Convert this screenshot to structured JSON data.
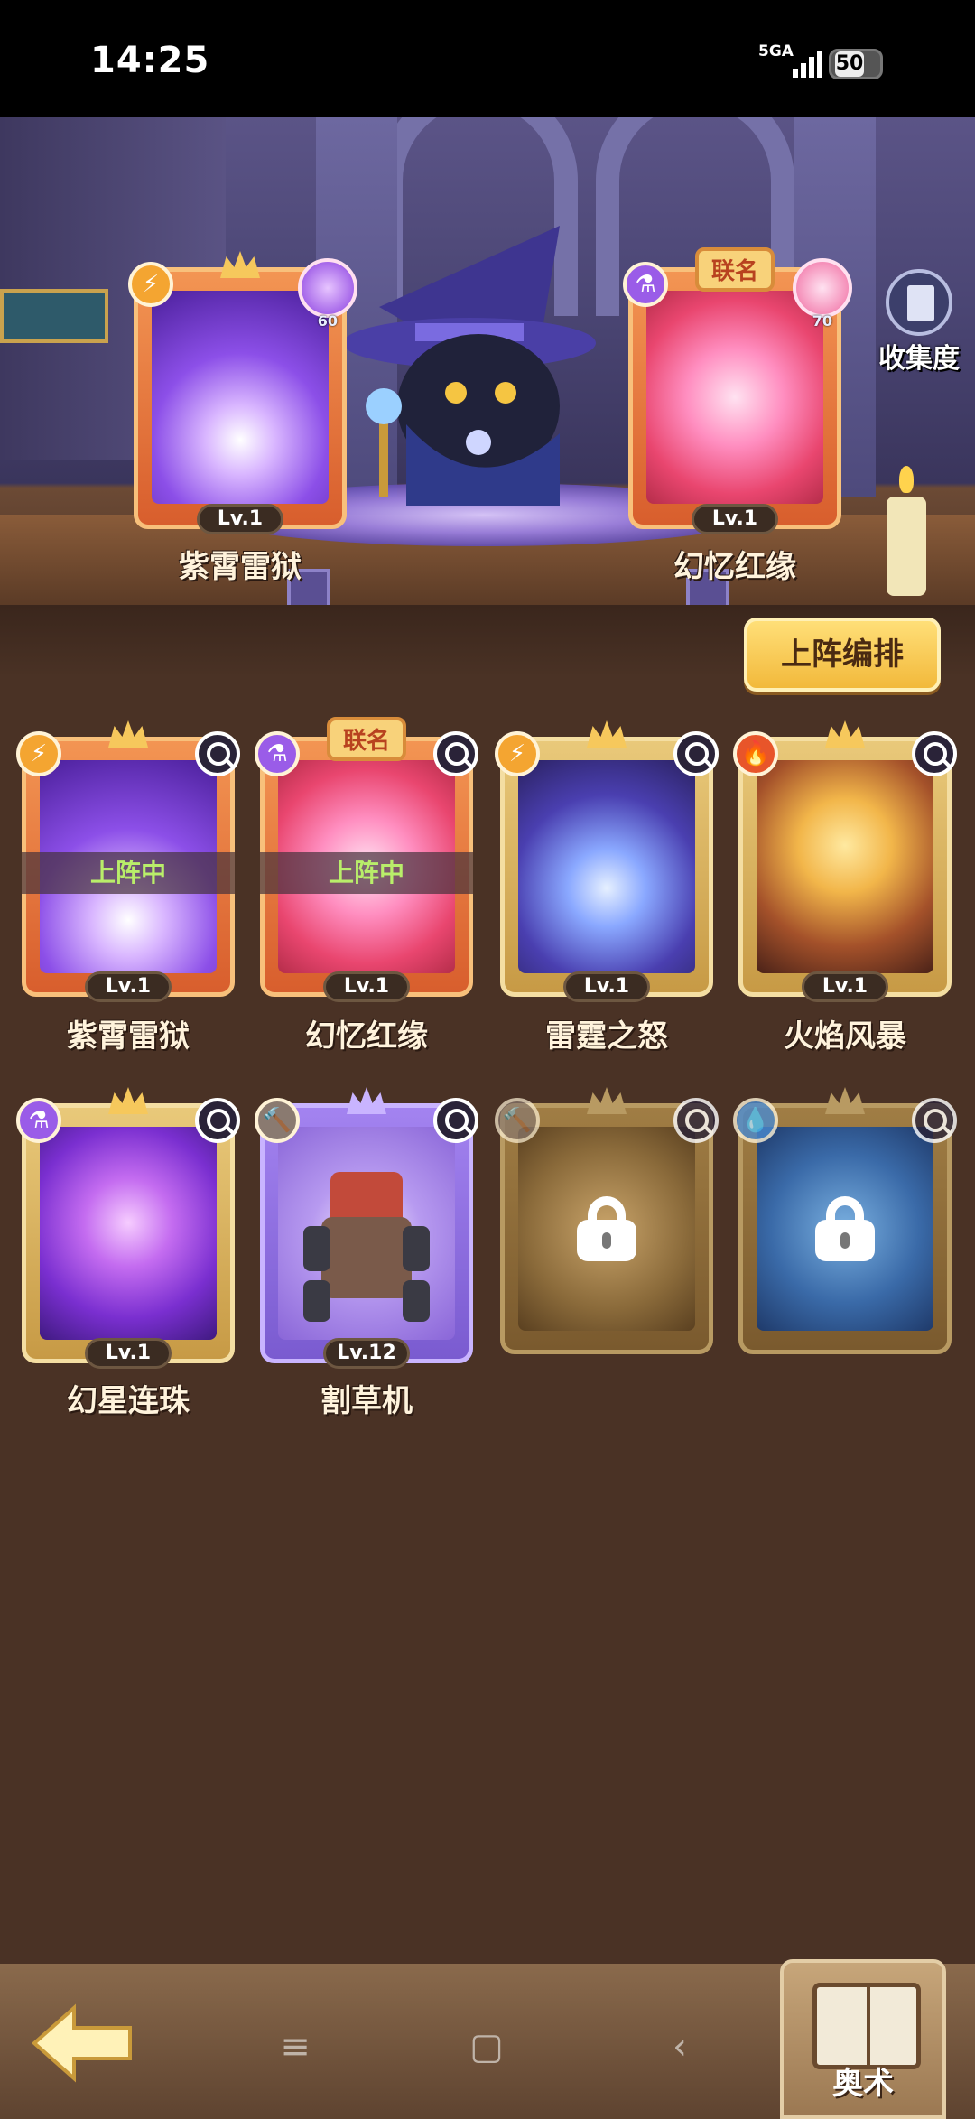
{
  "status_bar": {
    "time": "14:25",
    "network": "5GA",
    "battery": "50"
  },
  "collection": {
    "label": "收集度"
  },
  "equipped": [
    {
      "name": "紫霄雷狱",
      "level": "Lv.1",
      "power": "60",
      "element_icon": "lightning-icon",
      "frame": "orange",
      "tag": ""
    },
    {
      "name": "幻忆红缘",
      "level": "Lv.1",
      "power": "70",
      "element_icon": "potion-icon",
      "frame": "orange",
      "tag": "联名"
    }
  ],
  "arrange_button": "上阵编排",
  "cards": [
    {
      "name": "紫霄雷狱",
      "level": "Lv.1",
      "status": "上阵中",
      "tag": "",
      "element_icon": "lightning-icon",
      "frame": "orange",
      "locked": false
    },
    {
      "name": "幻忆红缘",
      "level": "Lv.1",
      "status": "上阵中",
      "tag": "联名",
      "element_icon": "potion-icon",
      "frame": "orange",
      "locked": false
    },
    {
      "name": "雷霆之怒",
      "level": "Lv.1",
      "status": "",
      "tag": "",
      "element_icon": "lightning-icon",
      "frame": "gold",
      "locked": false
    },
    {
      "name": "火焰风暴",
      "level": "Lv.1",
      "status": "",
      "tag": "",
      "element_icon": "fire-icon",
      "frame": "gold",
      "locked": false
    },
    {
      "name": "幻星连珠",
      "level": "Lv.1",
      "status": "",
      "tag": "",
      "element_icon": "potion-icon",
      "frame": "gold",
      "locked": false
    },
    {
      "name": "割草机",
      "level": "Lv.12",
      "status": "",
      "tag": "",
      "element_icon": "hammer-icon",
      "frame": "purple",
      "locked": false
    },
    {
      "name": "",
      "level": "",
      "status": "",
      "tag": "",
      "element_icon": "hammer-icon",
      "frame": "gold",
      "locked": true
    },
    {
      "name": "",
      "level": "",
      "status": "",
      "tag": "",
      "element_icon": "water-drop-icon",
      "frame": "gold",
      "locked": true
    }
  ],
  "bottom": {
    "arcane_label": "奥术",
    "back_icon": "back-arrow-icon"
  },
  "colors": {
    "panel": "#4a3225",
    "level_chip": "#3b2c22",
    "deployed_text": "#b9ee6a",
    "button": "#f2b93b"
  }
}
